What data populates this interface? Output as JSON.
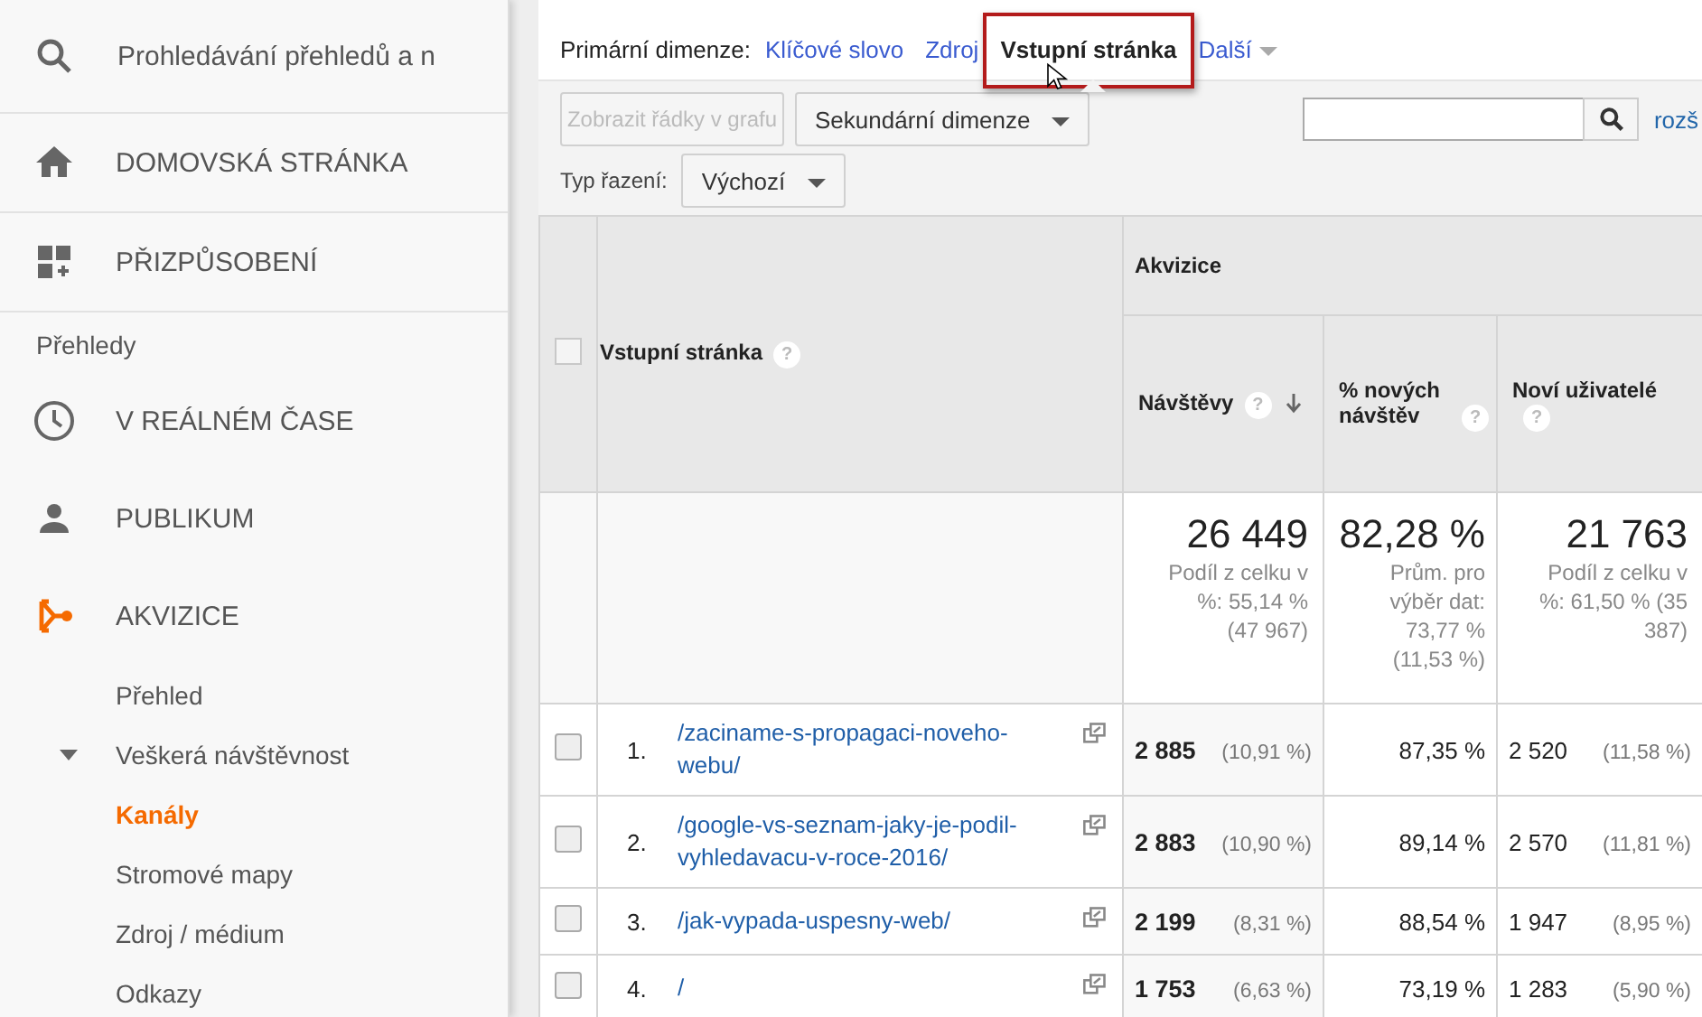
{
  "sidebar": {
    "search": {
      "placeholder": "Prohledávání přehledů a n"
    },
    "items": [
      {
        "kind": "main",
        "label": "DOMOVSKÁ STRÁNKA",
        "selected": false
      },
      {
        "kind": "main",
        "label": "PŘIZPŮSOBENÍ",
        "selected": false
      },
      {
        "kind": "heading",
        "label": "Přehledy"
      },
      {
        "kind": "main",
        "label": "V REÁLNÉM ČASE",
        "selected": false
      },
      {
        "kind": "main",
        "label": "PUBLIKUM",
        "selected": false
      },
      {
        "kind": "main",
        "label": "AKVIZICE",
        "selected": true,
        "children": [
          {
            "label": "Přehled",
            "selected": false
          },
          {
            "label": "Veškerá návštěvnost",
            "selected": false,
            "expanded": true,
            "children": [
              {
                "label": "Kanály",
                "selected": true
              },
              {
                "label": "Stromové mapy",
                "selected": false
              },
              {
                "label": "Zdroj / médium",
                "selected": false
              },
              {
                "label": "Odkazy",
                "selected": false
              }
            ]
          }
        ]
      }
    ]
  },
  "dimensions": {
    "label": "Primární dimenze:",
    "options": [
      {
        "label": "Klíčové slovo",
        "selected": false
      },
      {
        "label": "Zdroj",
        "selected": false
      },
      {
        "label": "Vstupní stránka",
        "selected": true
      },
      {
        "label": "Další",
        "selected": false,
        "dropdown": true
      }
    ]
  },
  "toolbar": {
    "plot_button": {
      "label": "Zobrazit řádky v grafu",
      "disabled": true
    },
    "secondary_dimension": "Sekundární dimenze",
    "advanced_link": "rozš",
    "sort_label": "Typ řazení:",
    "sort_value": "Výchozí"
  },
  "table": {
    "group": "Akvizice",
    "help": "?",
    "select_all_checked": false,
    "columns": [
      {
        "label": "Vstupní stránka",
        "help": true,
        "sorted": false
      },
      {
        "label": "Návštěvy",
        "help": true,
        "sorted": true
      },
      {
        "label": "% nových návštěv",
        "help": true,
        "sorted": false
      },
      {
        "label": "Noví uživatelé",
        "help": true,
        "sorted": false
      }
    ],
    "totals": [
      {
        "value": "26 449",
        "note": "Podíl z celku v %: 55,14 % (47 967)"
      },
      {
        "value": "82,28 %",
        "note": "Prům. pro výběr dat: 73,77 % (11,53 %)"
      },
      {
        "value": "21 763",
        "note": "Podíl z celku v %: 61,50 % (35 387)"
      }
    ],
    "rows": [
      {
        "checked": false,
        "index": "1.",
        "page": "/zaciname-s-propagaci-noveho-webu/",
        "visits": "2 885",
        "visits_share": "(10,91 %)",
        "new_rate": "87,35 %",
        "new_users": "2 520",
        "new_users_share": "(11,58 %)"
      },
      {
        "checked": false,
        "index": "2.",
        "page": "/google-vs-seznam-jaky-je-podil-vyhledavacu-v-roce-2016/",
        "visits": "2 883",
        "visits_share": "(10,90 %)",
        "new_rate": "89,14 %",
        "new_users": "2 570",
        "new_users_share": "(11,81 %)"
      },
      {
        "checked": false,
        "index": "3.",
        "page": "/jak-vypada-uspesny-web/",
        "visits": "2 199",
        "visits_share": "(8,31 %)",
        "new_rate": "88,54 %",
        "new_users": "1 947",
        "new_users_share": "(8,95 %)"
      },
      {
        "checked": false,
        "index": "4.",
        "page": "/",
        "visits": "1 753",
        "visits_share": "(6,63 %)",
        "new_rate": "73,19 %",
        "new_users": "1 283",
        "new_users_share": "(5,90 %)"
      }
    ]
  }
}
